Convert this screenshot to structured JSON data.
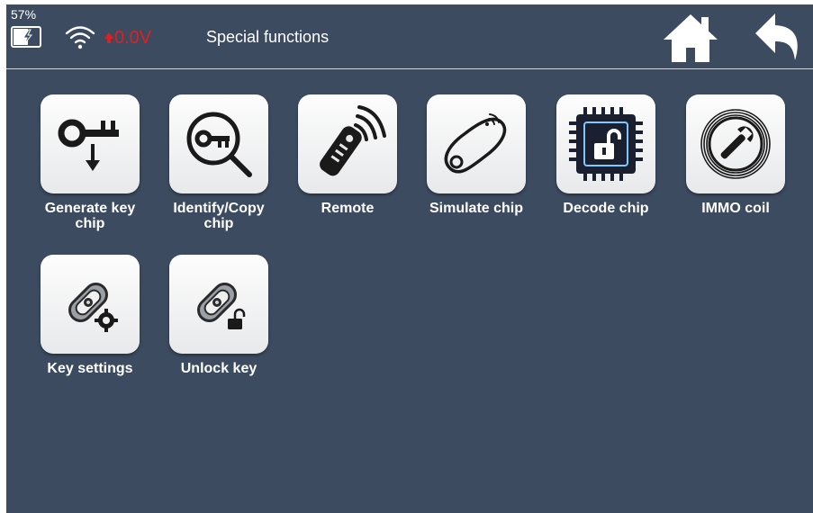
{
  "status": {
    "battery_percent": "57%",
    "voltage": "0.0V",
    "battery_icon": "battery-charging-icon",
    "wifi_icon": "wifi-icon",
    "voltage_icon": "car-battery-icon"
  },
  "header": {
    "title": "Special functions",
    "home_icon": "home-icon",
    "back_icon": "back-arrow-icon"
  },
  "colors": {
    "background": "#3c4b60",
    "text": "#ffffff",
    "voltage": "#e02020",
    "tile": "#f2f2f3"
  },
  "functions": [
    {
      "label": "Generate key\nchip",
      "icon": "key-download-icon"
    },
    {
      "label": "Identify/Copy\nchip",
      "icon": "key-search-icon"
    },
    {
      "label": "Remote",
      "icon": "remote-signal-icon"
    },
    {
      "label": "Simulate chip",
      "icon": "chip-transponder-icon"
    },
    {
      "label": "Decode chip",
      "icon": "chip-unlock-icon"
    },
    {
      "label": "IMMO coil",
      "icon": "coil-wrench-icon"
    },
    {
      "label": "Key settings",
      "icon": "car-key-gear-icon"
    },
    {
      "label": "Unlock key",
      "icon": "car-key-lock-icon"
    }
  ]
}
